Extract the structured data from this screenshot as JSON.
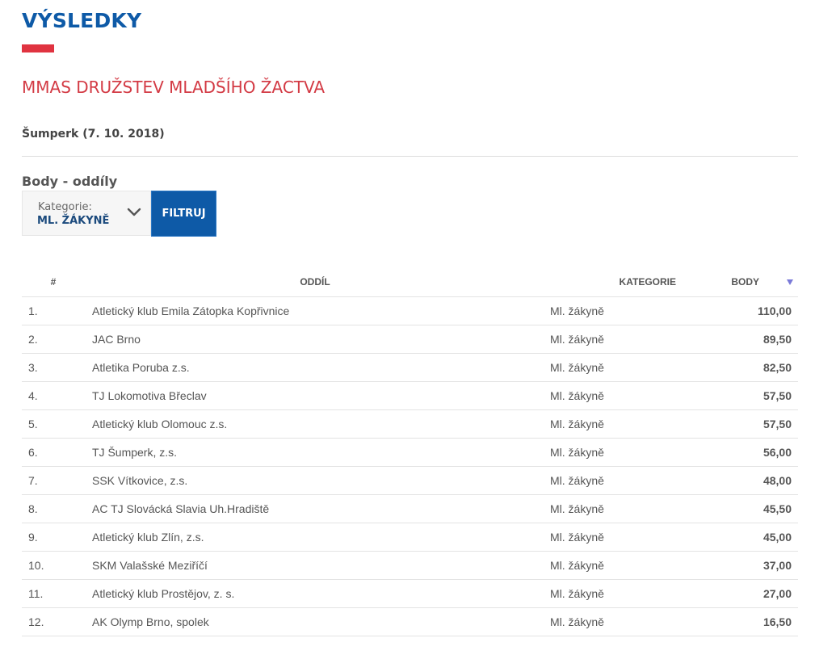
{
  "page": {
    "title": "VÝSLEDKY"
  },
  "event": {
    "title": "MMAS DRUŽSTEV MLADŠÍHO ŽACTVA",
    "location": "Šumperk (7. 10. 2018)"
  },
  "section": {
    "title": "Body - oddíly"
  },
  "filter": {
    "category_label": "Kategorie:",
    "category_value": "ML. ŽÁKYNĚ",
    "button_label": "FILTRUJ"
  },
  "table": {
    "headers": {
      "rank": "#",
      "club": "ODDÍL",
      "category": "KATEGORIE",
      "points": "BODY"
    },
    "sort": {
      "column": "points",
      "direction": "desc"
    },
    "rows": [
      {
        "rank": "1.",
        "club": "Atletický klub Emila Zátopka Kopřivnice",
        "category": "Ml. žákyně",
        "points": "110,00"
      },
      {
        "rank": "2.",
        "club": "JAC Brno",
        "category": "Ml. žákyně",
        "points": "89,50"
      },
      {
        "rank": "3.",
        "club": "Atletika Poruba z.s.",
        "category": "Ml. žákyně",
        "points": "82,50"
      },
      {
        "rank": "4.",
        "club": "TJ Lokomotiva Břeclav",
        "category": "Ml. žákyně",
        "points": "57,50"
      },
      {
        "rank": "5.",
        "club": "Atletický klub Olomouc z.s.",
        "category": "Ml. žákyně",
        "points": "57,50"
      },
      {
        "rank": "6.",
        "club": "TJ Šumperk, z.s.",
        "category": "Ml. žákyně",
        "points": "56,00"
      },
      {
        "rank": "7.",
        "club": "SSK Vítkovice, z.s.",
        "category": "Ml. žákyně",
        "points": "48,00"
      },
      {
        "rank": "8.",
        "club": "AC TJ Slovácká Slavia Uh.Hradiště",
        "category": "Ml. žákyně",
        "points": "45,50"
      },
      {
        "rank": "9.",
        "club": "Atletický klub Zlín, z.s.",
        "category": "Ml. žákyně",
        "points": "45,00"
      },
      {
        "rank": "10.",
        "club": "SKM Valašské Meziříčí",
        "category": "Ml. žákyně",
        "points": "37,00"
      },
      {
        "rank": "11.",
        "club": "Atletický klub Prostějov, z. s.",
        "category": "Ml. žákyně",
        "points": "27,00"
      },
      {
        "rank": "12.",
        "club": "AK Olymp Brno, spolek",
        "category": "Ml. žákyně",
        "points": "16,50"
      }
    ]
  },
  "colors": {
    "primary_blue": "#0e5aa7",
    "accent_red": "#e03340",
    "event_red": "#d33a44",
    "sort_icon": "#7a7ad8"
  },
  "icons": {
    "select": "chevron-down-icon",
    "sort": "sort-desc-icon"
  }
}
